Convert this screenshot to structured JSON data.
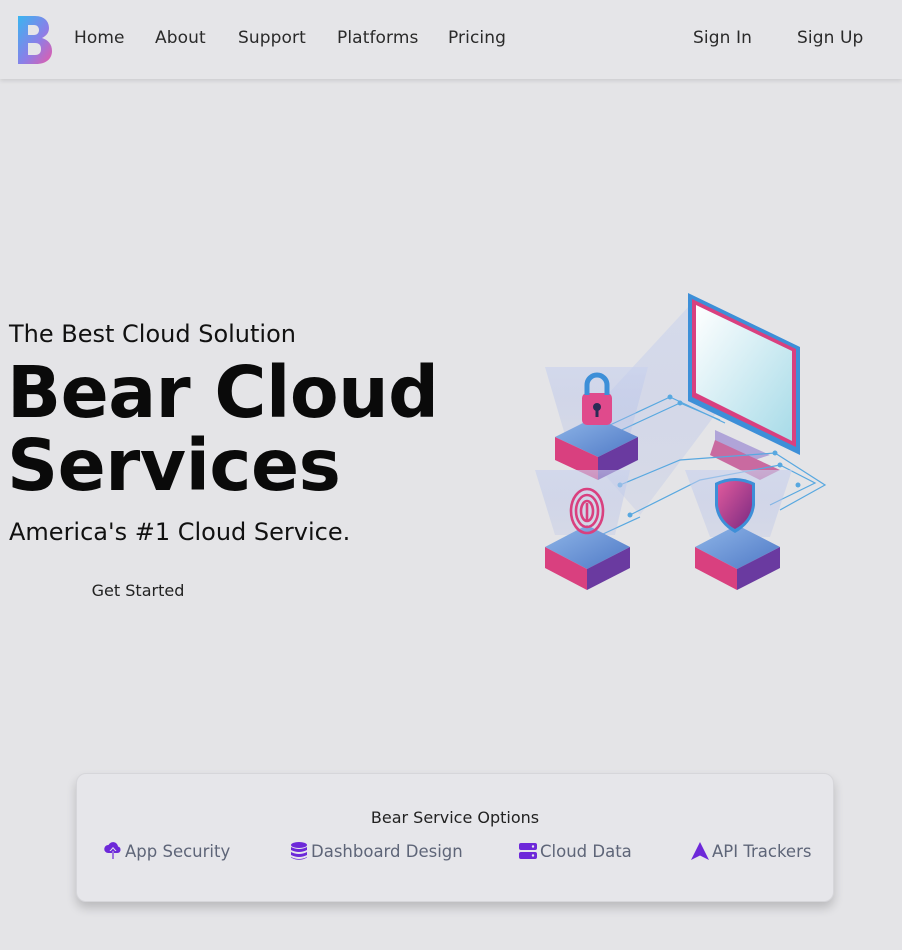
{
  "nav": {
    "logo_letter": "B",
    "links": [
      "Home",
      "About",
      "Support",
      "Platforms",
      "Pricing"
    ],
    "sign_in": "Sign In",
    "sign_up": "Sign Up"
  },
  "hero": {
    "tagline": "The Best Cloud Solution",
    "headline_line1": "Bear Cloud",
    "headline_line2": "Services",
    "subheadline": "America's #1 Cloud Service.",
    "cta_label": "Get Started",
    "illustration": "cloud-security-isometric-illustration"
  },
  "services": {
    "title": "Bear Service Options",
    "options": [
      {
        "label": "App Security",
        "icon": "cloud-upload-icon"
      },
      {
        "label": "Dashboard Design",
        "icon": "database-icon"
      },
      {
        "label": "Cloud Data",
        "icon": "server-icon"
      },
      {
        "label": "API Trackers",
        "icon": "arrow-a-icon"
      }
    ]
  },
  "colors": {
    "background": "#e4e4e7",
    "icon_purple": "#6d28d9",
    "option_text": "#5e6578",
    "brand_pink": "#e0408a",
    "brand_blue": "#3aa0e0"
  }
}
